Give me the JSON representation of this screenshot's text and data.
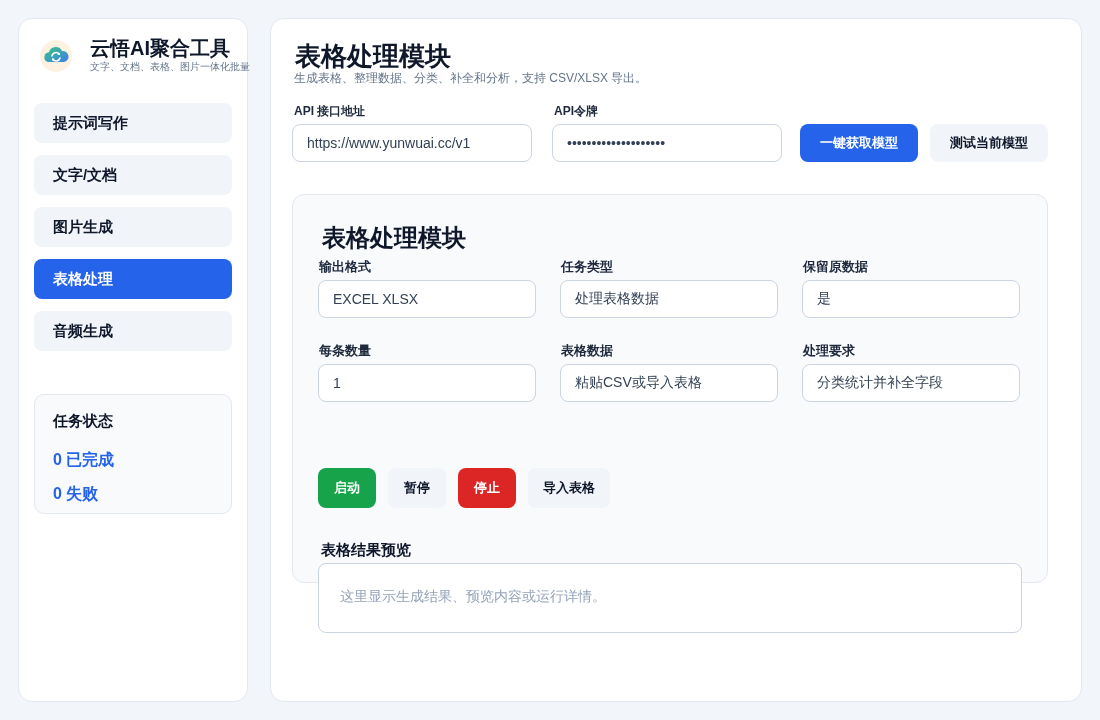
{
  "sidebar": {
    "app_title": "云悟AI聚合工具",
    "app_subtitle": "文字、文档、表格、图片一体化批量",
    "nav_items": [
      {
        "label": "提示词写作",
        "selected": false
      },
      {
        "label": "文字/文档",
        "selected": false
      },
      {
        "label": "图片生成",
        "selected": false
      },
      {
        "label": "表格处理",
        "selected": true
      },
      {
        "label": "音频生成",
        "selected": false
      }
    ],
    "status_panel": {
      "title": "任务状态",
      "stats": [
        "0 已完成",
        "0 失败"
      ]
    }
  },
  "main": {
    "title": "表格处理模块",
    "subtitle": "生成表格、整理数据、分类、补全和分析，支持 CSV/XLSX 导出。",
    "api_fields": [
      {
        "label": "API 接口地址",
        "value": "https://www.yunwuai.cc/v1"
      },
      {
        "label": "API令牌",
        "value": "••••••••••••••••••••"
      }
    ],
    "header_buttons": [
      {
        "label": "一键获取模型",
        "kind": "primary"
      },
      {
        "label": "测试当前模型",
        "kind": "neutral"
      }
    ],
    "module_panel": {
      "title": "表格处理模块",
      "fields": [
        {
          "label": "输出格式",
          "value": "EXCEL XLSX"
        },
        {
          "label": "任务类型",
          "value": "处理表格数据"
        },
        {
          "label": "保留原数据",
          "value": "是"
        },
        {
          "label": "每条数量",
          "value": "1"
        },
        {
          "label": "表格数据",
          "value": "粘贴CSV或导入表格"
        },
        {
          "label": "处理要求",
          "value": "分类统计并补全字段"
        }
      ],
      "actions": [
        {
          "label": "启动",
          "kind": "success"
        },
        {
          "label": "暂停",
          "kind": "neutral"
        },
        {
          "label": "停止",
          "kind": "danger"
        },
        {
          "label": "导入表格",
          "kind": "neutral"
        }
      ],
      "preview": {
        "title": "表格结果预览",
        "placeholder": "这里显示生成结果、预览内容或运行详情。"
      }
    }
  }
}
